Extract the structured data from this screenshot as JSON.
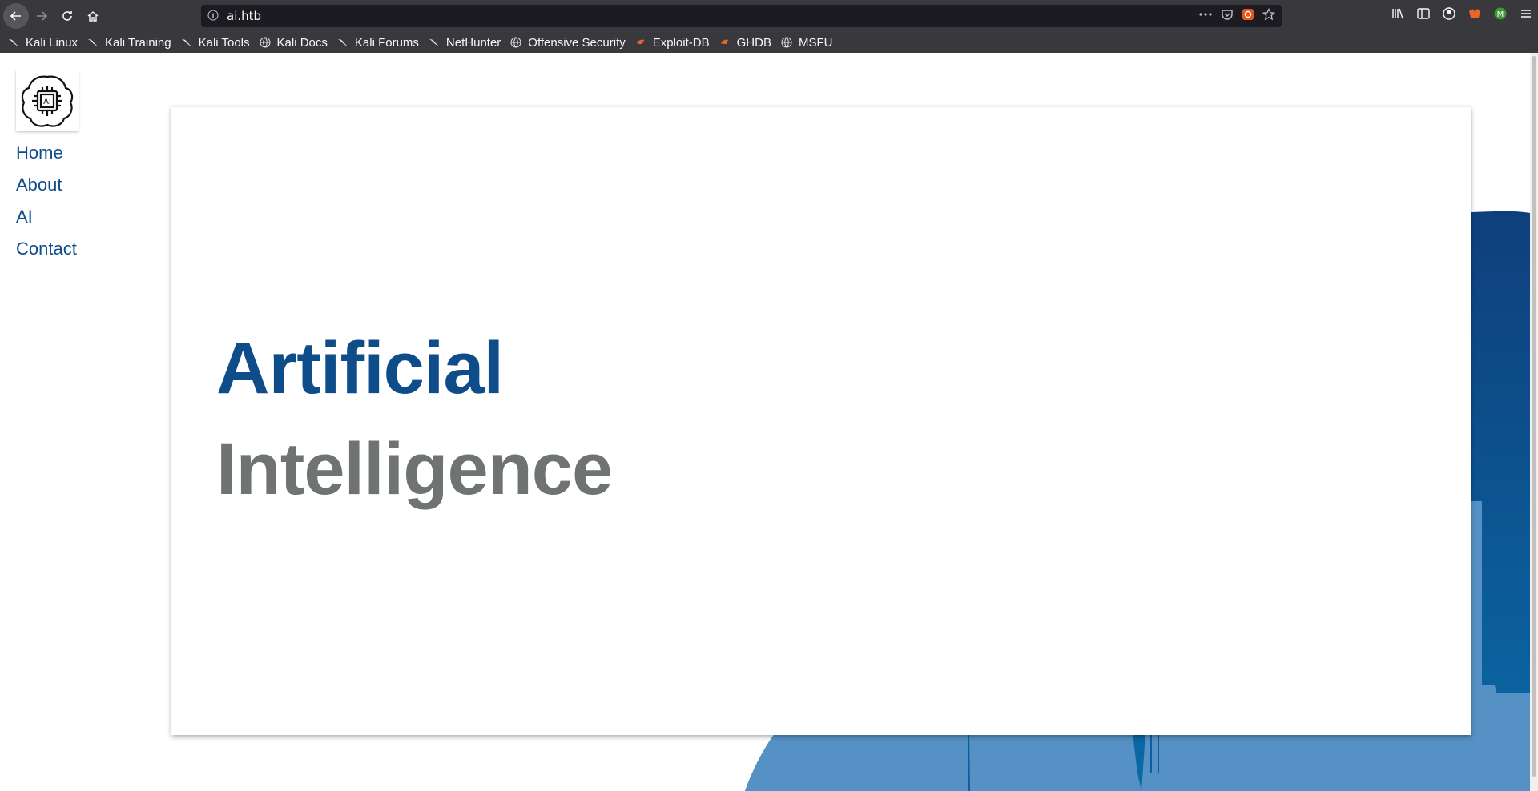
{
  "browser": {
    "url": "ai.htb",
    "bookmarks": [
      {
        "label": "Kali Linux",
        "icon": "kali-dragon-icon"
      },
      {
        "label": "Kali Training",
        "icon": "kali-dragon-icon"
      },
      {
        "label": "Kali Tools",
        "icon": "kali-dragon-icon"
      },
      {
        "label": "Kali Docs",
        "icon": "globe-icon"
      },
      {
        "label": "Kali Forums",
        "icon": "kali-dragon-icon"
      },
      {
        "label": "NetHunter",
        "icon": "kali-dragon-icon"
      },
      {
        "label": "Offensive Security",
        "icon": "globe-icon"
      },
      {
        "label": "Exploit-DB",
        "icon": "exploit-db-icon"
      },
      {
        "label": "GHDB",
        "icon": "exploit-db-icon"
      },
      {
        "label": "MSFU",
        "icon": "globe-icon"
      }
    ]
  },
  "site": {
    "logo_text": "AI",
    "nav": [
      "Home",
      "About",
      "AI",
      "Contact"
    ],
    "headline_line1": "Artificial",
    "headline_line2": "Intelligence"
  },
  "colors": {
    "brand_blue": "#0e4d8a",
    "headline_gray": "#6f7374",
    "wave_dark": "#0b4a86",
    "skyline_light": "#5b95c7",
    "chrome_bg": "#38383d"
  }
}
